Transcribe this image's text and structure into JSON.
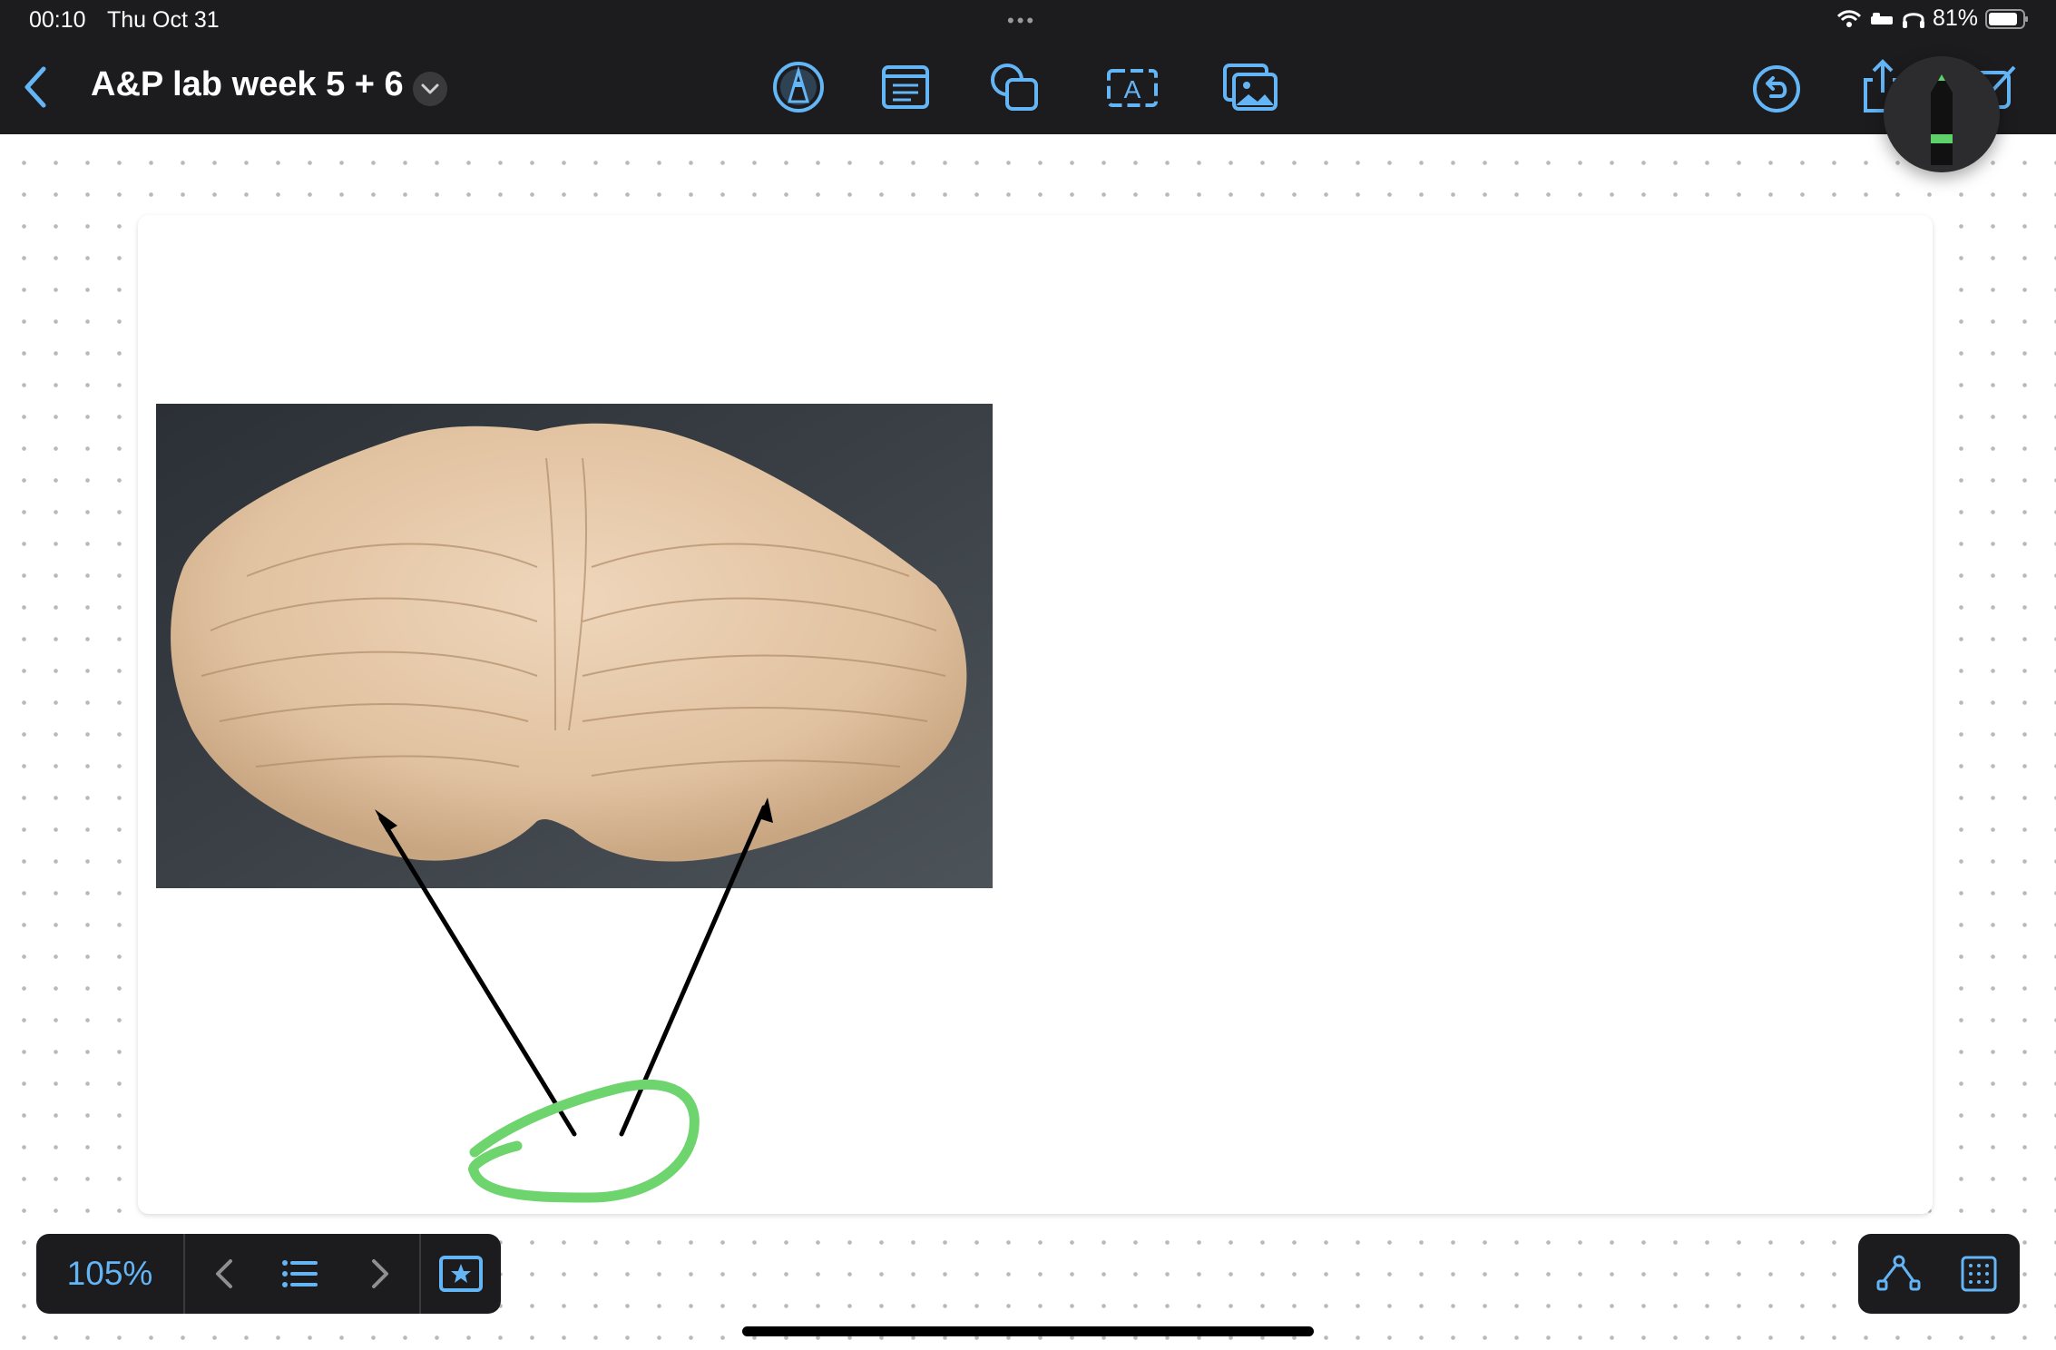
{
  "status_bar": {
    "time": "00:10",
    "date": "Thu Oct 31",
    "battery": "81%",
    "icons": [
      "wifi-icon",
      "sleep-icon",
      "headphones-icon",
      "battery-icon"
    ]
  },
  "nav": {
    "back_icon": "chevron-left-icon",
    "title": "A&P lab week 5 + 6",
    "title_menu_icon": "chevron-down-icon"
  },
  "toolbar": {
    "tools": [
      {
        "id": "pen-tool",
        "icon": "pen-circle-icon"
      },
      {
        "id": "text-note-tool",
        "icon": "note-icon"
      },
      {
        "id": "shapes-tool",
        "icon": "shapes-icon"
      },
      {
        "id": "text-box-tool",
        "icon": "text-box-icon",
        "glyph": "A"
      },
      {
        "id": "image-tool",
        "icon": "image-icon"
      }
    ],
    "right": [
      "undo-icon",
      "share-icon",
      "compose-icon"
    ]
  },
  "floating_pen": {
    "icon": "pencil-icon",
    "color": "#5fd16b"
  },
  "board": {
    "image": {
      "subject": "cerebellum model photo",
      "icon": "photo"
    },
    "annotations": {
      "arrow_color": "#000000",
      "circle_color": "#6dd46e"
    }
  },
  "bottom_left": {
    "zoom": "105%",
    "buttons": [
      "chevron-left-icon",
      "list-icon",
      "chevron-right-icon",
      "star-frame-icon"
    ]
  },
  "bottom_right": {
    "buttons": [
      "lasso-shapes-icon",
      "grid-icon"
    ]
  },
  "colors": {
    "accent": "#64b5f6",
    "bar": "#1c1c1e",
    "canvas": "#ffffff"
  }
}
